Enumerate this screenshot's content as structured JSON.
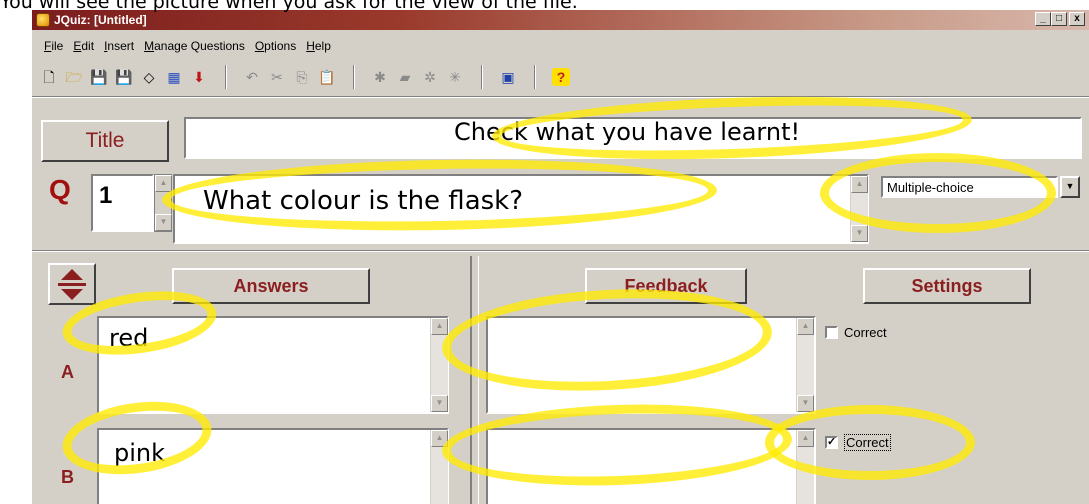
{
  "caption": "You will see the picture when you ask for the view of the file.",
  "window": {
    "title": "JQuiz: [Untitled]",
    "controls": {
      "minimize": "_",
      "maximize": "□",
      "close": "x"
    }
  },
  "menu": [
    "File",
    "Edit",
    "Insert",
    "Manage Questions",
    "Options",
    "Help"
  ],
  "toolbar": {
    "icons": [
      "new-file-icon",
      "open-folder-icon",
      "save-icon",
      "save-as-icon",
      "web-page-icon",
      "export-icon",
      "download-icon",
      "undo-icon",
      "cut-icon",
      "copy-icon",
      "paste-icon",
      "tool-a-icon",
      "tool-b-icon",
      "tool-c-icon",
      "tool-d-icon",
      "web-preview-icon",
      "help-icon"
    ]
  },
  "title_button": "Title",
  "title_value": "Check what you have learnt!",
  "question": {
    "label": "Q",
    "number": "1",
    "text": "What colour is the flask?",
    "type": "Multiple-choice"
  },
  "headers": {
    "answers": "Answers",
    "feedback": "Feedback",
    "settings": "Settings"
  },
  "answers": [
    {
      "letter": "A",
      "text": "red",
      "feedback": "",
      "correct": false,
      "correct_label": "Correct"
    },
    {
      "letter": "B",
      "text": "pink",
      "feedback": "",
      "correct": true,
      "correct_label": "Correct"
    }
  ],
  "colors": {
    "highlight": "#ffeb00",
    "accent": "#8b1e1e",
    "face": "#d4d0c8"
  }
}
